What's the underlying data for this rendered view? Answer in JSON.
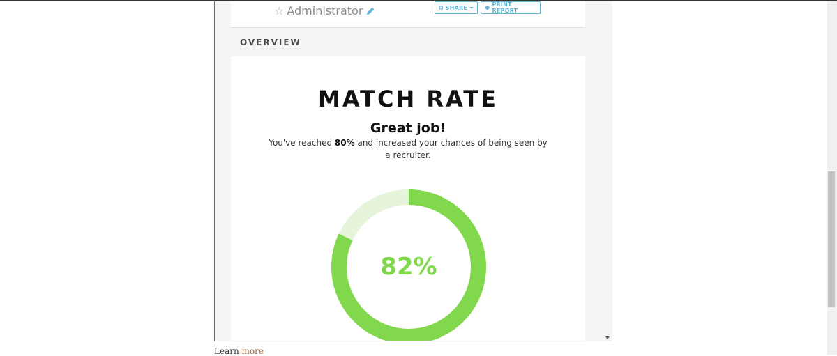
{
  "profile": {
    "role": "Administrator",
    "share_label": "SHARE",
    "print_label": "PRINT REPORT"
  },
  "overview": {
    "label": "OVERVIEW"
  },
  "match": {
    "title": "MATCH RATE",
    "headline": "Great job!",
    "desc_prefix": "You've reached ",
    "desc_bold": "80%",
    "desc_suffix": " and increased your chances of being seen by a recruiter.",
    "percent_label": "82%",
    "percent_value": 82,
    "ring_color": "#82d84c",
    "track_color": "#e6f5da"
  },
  "footer": {
    "learn_prefix": "Learn ",
    "learn_link": "more"
  },
  "icons": [
    "star-icon",
    "pencil-icon",
    "share-icon",
    "caret-down-icon",
    "printer-icon"
  ]
}
